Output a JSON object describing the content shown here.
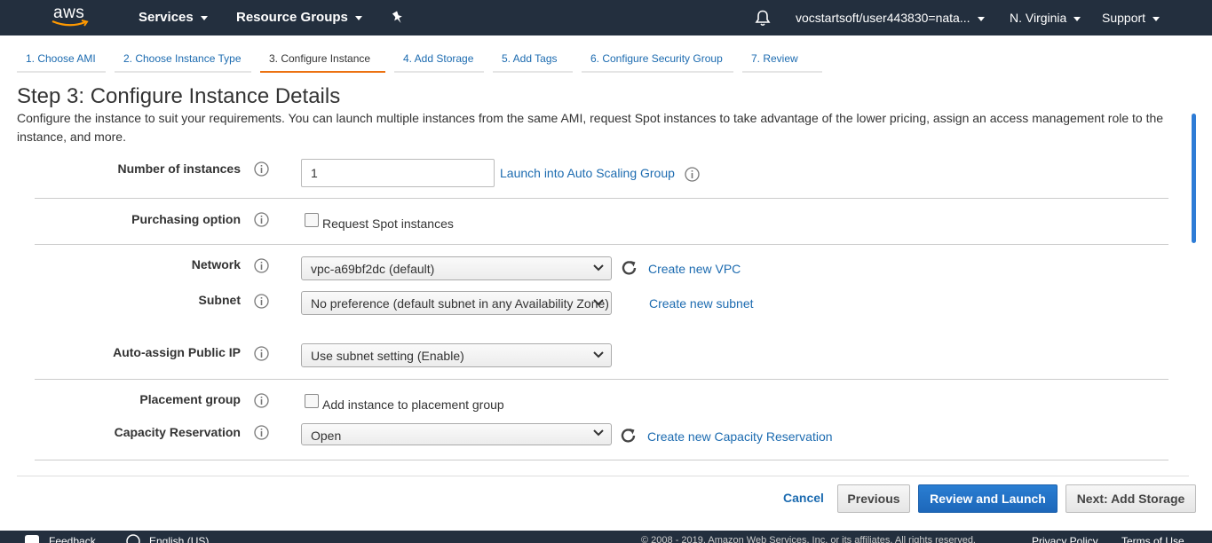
{
  "topnav": {
    "logo_text": "aws",
    "services_label": "Services",
    "resource_groups_label": "Resource Groups",
    "account_label": "vocstartsoft/user443830=nata...",
    "region_label": "N. Virginia",
    "support_label": "Support"
  },
  "wizard": {
    "tabs": [
      {
        "label": "1. Choose AMI"
      },
      {
        "label": "2. Choose Instance Type"
      },
      {
        "label": "3. Configure Instance"
      },
      {
        "label": "4. Add Storage"
      },
      {
        "label": "5. Add Tags"
      },
      {
        "label": "6. Configure Security Group"
      },
      {
        "label": "7. Review"
      }
    ],
    "active_tab_index": 2
  },
  "page": {
    "title": "Step 3: Configure Instance Details",
    "description": "Configure the instance to suit your requirements. You can launch multiple instances from the same AMI, request Spot instances to take advantage of the lower pricing, assign an access management role to the instance, and more."
  },
  "form": {
    "number_of_instances": {
      "label": "Number of instances",
      "value": "1",
      "link": "Launch into Auto Scaling Group"
    },
    "purchasing_option": {
      "label": "Purchasing option",
      "checkbox_label": "Request Spot instances",
      "checked": false
    },
    "network": {
      "label": "Network",
      "value": "vpc-a69bf2dc (default)",
      "link": "Create new VPC"
    },
    "subnet": {
      "label": "Subnet",
      "value": "No preference (default subnet in any Availability Zone)",
      "link": "Create new subnet"
    },
    "auto_assign_ip": {
      "label": "Auto-assign Public IP",
      "value": "Use subnet setting (Enable)"
    },
    "placement_group": {
      "label": "Placement group",
      "checkbox_label": "Add instance to placement group",
      "checked": false
    },
    "capacity_reservation": {
      "label": "Capacity Reservation",
      "value": "Open",
      "link": "Create new Capacity Reservation"
    }
  },
  "actions": {
    "cancel": "Cancel",
    "previous": "Previous",
    "review_launch": "Review and Launch",
    "next": "Next: Add Storage"
  },
  "footer": {
    "feedback": "Feedback",
    "language": "English (US)",
    "copyright": "© 2008 - 2019, Amazon Web Services, Inc. or its affiliates. All rights reserved.",
    "privacy": "Privacy Policy",
    "terms": "Terms of Use"
  },
  "colors": {
    "nav_bg": "#232f3e",
    "link": "#1c6bb0",
    "active_tab": "#ec7211",
    "primary_button": "#1d67ba"
  }
}
